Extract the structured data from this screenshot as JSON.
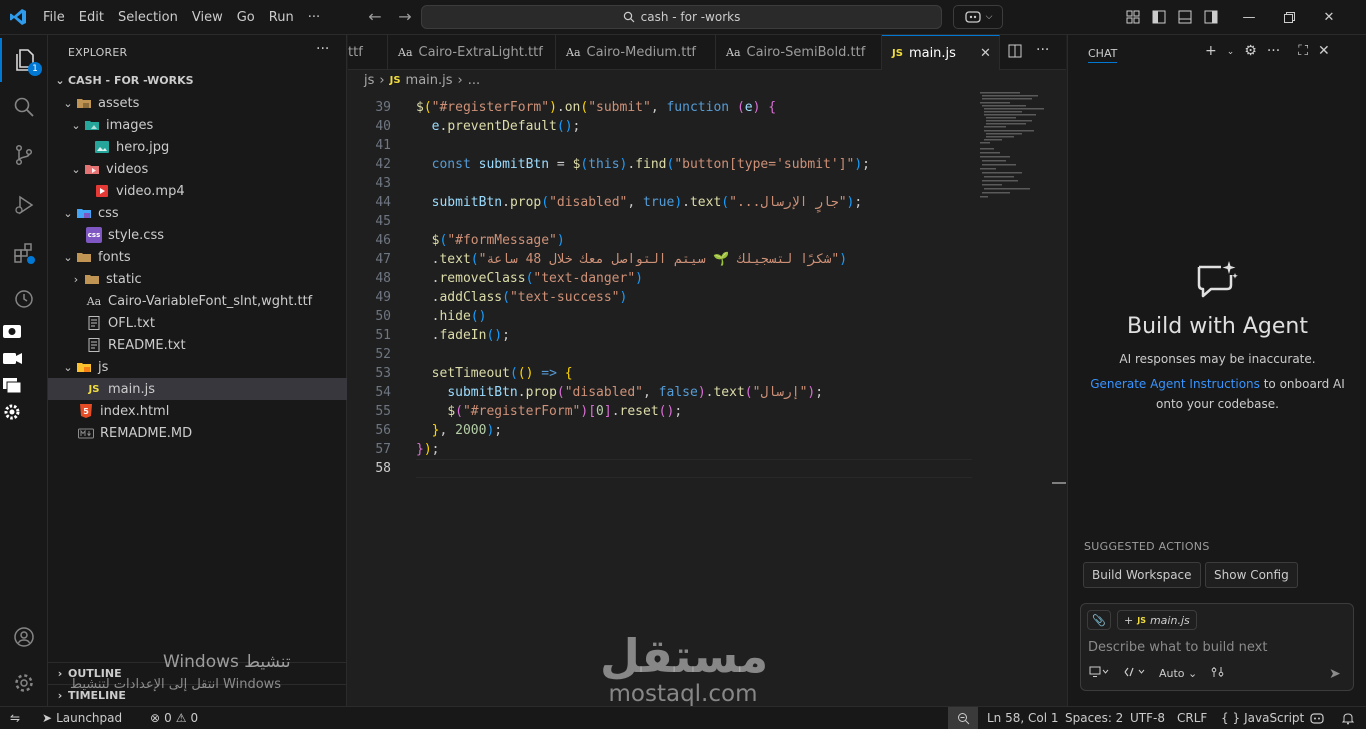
{
  "titlebar": {
    "menu": [
      "File",
      "Edit",
      "Selection",
      "View",
      "Go",
      "Run",
      "···"
    ],
    "search_text": "cash - for -works"
  },
  "activity": {
    "explorer_badge": "1"
  },
  "explorer": {
    "title": "EXPLORER",
    "root": "CASH - FOR -WORKS",
    "items": [
      {
        "label": "assets",
        "kind": "folder",
        "open": true
      },
      {
        "label": "images",
        "kind": "folder",
        "open": true
      },
      {
        "label": "hero.jpg",
        "kind": "image"
      },
      {
        "label": "videos",
        "kind": "folder",
        "open": true
      },
      {
        "label": "video.mp4",
        "kind": "video"
      },
      {
        "label": "css",
        "kind": "folder",
        "open": true
      },
      {
        "label": "style.css",
        "kind": "css"
      },
      {
        "label": "fonts",
        "kind": "folder",
        "open": true
      },
      {
        "label": "static",
        "kind": "folder",
        "open": false
      },
      {
        "label": "Cairo-VariableFont_slnt,wght.ttf",
        "kind": "font"
      },
      {
        "label": "OFL.txt",
        "kind": "text"
      },
      {
        "label": "README.txt",
        "kind": "text"
      },
      {
        "label": "js",
        "kind": "folder",
        "open": true
      },
      {
        "label": "main.js",
        "kind": "js"
      },
      {
        "label": "index.html",
        "kind": "html"
      },
      {
        "label": "REMADME.MD",
        "kind": "md"
      }
    ],
    "outline": "OUTLINE",
    "timeline": "TIMELINE"
  },
  "tabs": [
    {
      "label": "ttf",
      "icon": "",
      "active": false
    },
    {
      "label": "Cairo-ExtraLight.ttf",
      "icon": "Aa",
      "active": false
    },
    {
      "label": "Cairo-Medium.ttf",
      "icon": "Aa",
      "active": false
    },
    {
      "label": "Cairo-SemiBold.ttf",
      "icon": "Aa",
      "active": false
    },
    {
      "label": "main.js",
      "icon": "JS",
      "active": true
    }
  ],
  "breadcrumb": {
    "folder": "js",
    "file": "main.js",
    "more": "..."
  },
  "code": {
    "line_numbers": [
      "39",
      "40",
      "41",
      "42",
      "43",
      "44",
      "45",
      "46",
      "47",
      "48",
      "49",
      "50",
      "51",
      "52",
      "53",
      "54",
      "55",
      "56",
      "57",
      "58"
    ],
    "current_line": "58"
  },
  "chat": {
    "title": "CHAT",
    "heading": "Build with Agent",
    "warning": "AI responses may be inaccurate.",
    "link": "Generate Agent Instructions",
    "desc_rest": " to onboard AI onto your codebase.",
    "suggested_label": "SUGGESTED ACTIONS",
    "suggestions": [
      "Build Workspace",
      "Show Config"
    ],
    "context_file": "main.js",
    "placeholder": "Describe what to build next",
    "mode": "Auto"
  },
  "statusbar": {
    "launchpad": "Launchpad",
    "errors": "0",
    "warnings": "0",
    "position": "Ln 58, Col 1",
    "spaces": "Spaces: 2",
    "encoding": "UTF-8",
    "eol": "CRLF",
    "language": "JavaScript"
  },
  "watermark": {
    "title": "Windows تنشيط",
    "subtitle": "انتقل إلى الإعدادات لتنشيط Windows",
    "brand_ar": "مستقل",
    "brand_en": "mostaql.com"
  },
  "colors": {
    "accent": "#0078d4",
    "link": "#3794ff",
    "js_icon": "#f1dd3f"
  }
}
